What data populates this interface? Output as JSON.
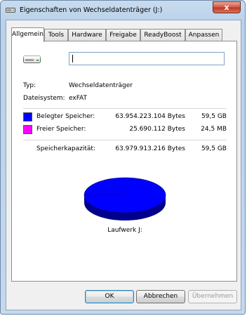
{
  "window": {
    "title": "Eigenschaften von Wechseldatenträger (J:)",
    "close_glyph": "x"
  },
  "tabs": [
    {
      "label": "Allgemein",
      "active": true
    },
    {
      "label": "Tools"
    },
    {
      "label": "Hardware"
    },
    {
      "label": "Freigabe"
    },
    {
      "label": "ReadyBoost"
    },
    {
      "label": "Anpassen"
    }
  ],
  "general": {
    "drive_name_value": "",
    "type_label": "Typ:",
    "type_value": "Wechseldatenträger",
    "fs_label": "Dateisystem:",
    "fs_value": "exFAT",
    "used": {
      "label": "Belegter Speicher:",
      "bytes": "63.954.223.104 Bytes",
      "size": "59,5 GB",
      "color": "#0000ff"
    },
    "free": {
      "label": "Freier Speicher:",
      "bytes": "25.690.112 Bytes",
      "size": "24,5 MB",
      "color": "#ff00ff"
    },
    "capacity": {
      "label": "Speicherkapazität:",
      "bytes": "63.979.913.216 Bytes",
      "size": "59,5 GB"
    },
    "drive_label": "Laufwerk J:"
  },
  "chart_data": {
    "type": "pie",
    "categories": [
      "Belegter Speicher",
      "Freier Speicher"
    ],
    "values": [
      63954223104,
      25690112
    ],
    "colors": [
      "#0000ff",
      "#ff00ff"
    ]
  },
  "buttons": {
    "ok": "OK",
    "cancel": "Abbrechen",
    "apply": "Übernehmen"
  }
}
